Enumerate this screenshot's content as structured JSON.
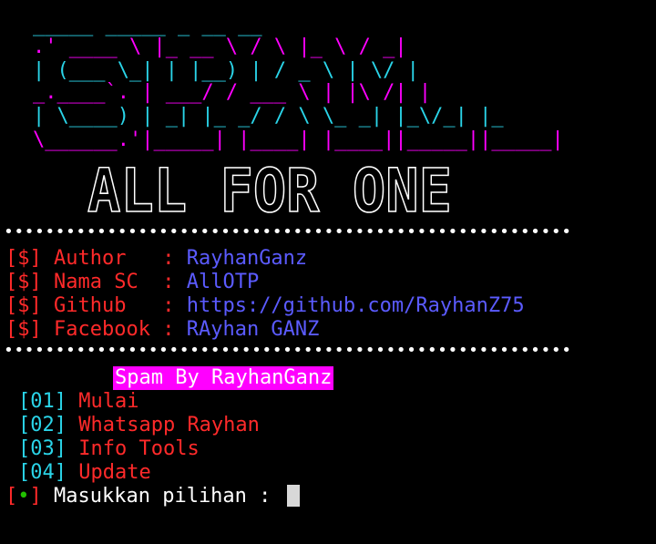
{
  "logo": {
    "title": "SPAM",
    "tagline": "ALL FOR ONE"
  },
  "info": [
    {
      "tag": "[$]",
      "label": "Author  ",
      "sep": " : ",
      "value": "RayhanGanz"
    },
    {
      "tag": "[$]",
      "label": "Nama SC ",
      "sep": " : ",
      "value": "AllOTP"
    },
    {
      "tag": "[$]",
      "label": "Github  ",
      "sep": " : ",
      "value": "https://github.com/RayhanZ75"
    },
    {
      "tag": "[$]",
      "label": "Facebook",
      "sep": " : ",
      "value": "RAyhan GANZ"
    }
  ],
  "separator": "•••••••••••••••••••••••••••••••••••••••••••••••••••••••",
  "banner": "Spam By RayhanGanz",
  "menu": [
    {
      "num": "[01]",
      "label": "Mulai"
    },
    {
      "num": "[02]",
      "label": "Whatsapp Rayhan"
    },
    {
      "num": "[03]",
      "label": "Info Tools"
    },
    {
      "num": "[04]",
      "label": "Update"
    }
  ],
  "prompt": {
    "open": "[",
    "dot": "•",
    "close": "]",
    "text": "Masukkan pilihan : "
  },
  "colors": {
    "background": "#000000",
    "red": "#ff2a2a",
    "blue": "#5b5bff",
    "cyan": "#2ad4e8",
    "magenta": "#ff00ff",
    "green": "#22c000"
  }
}
